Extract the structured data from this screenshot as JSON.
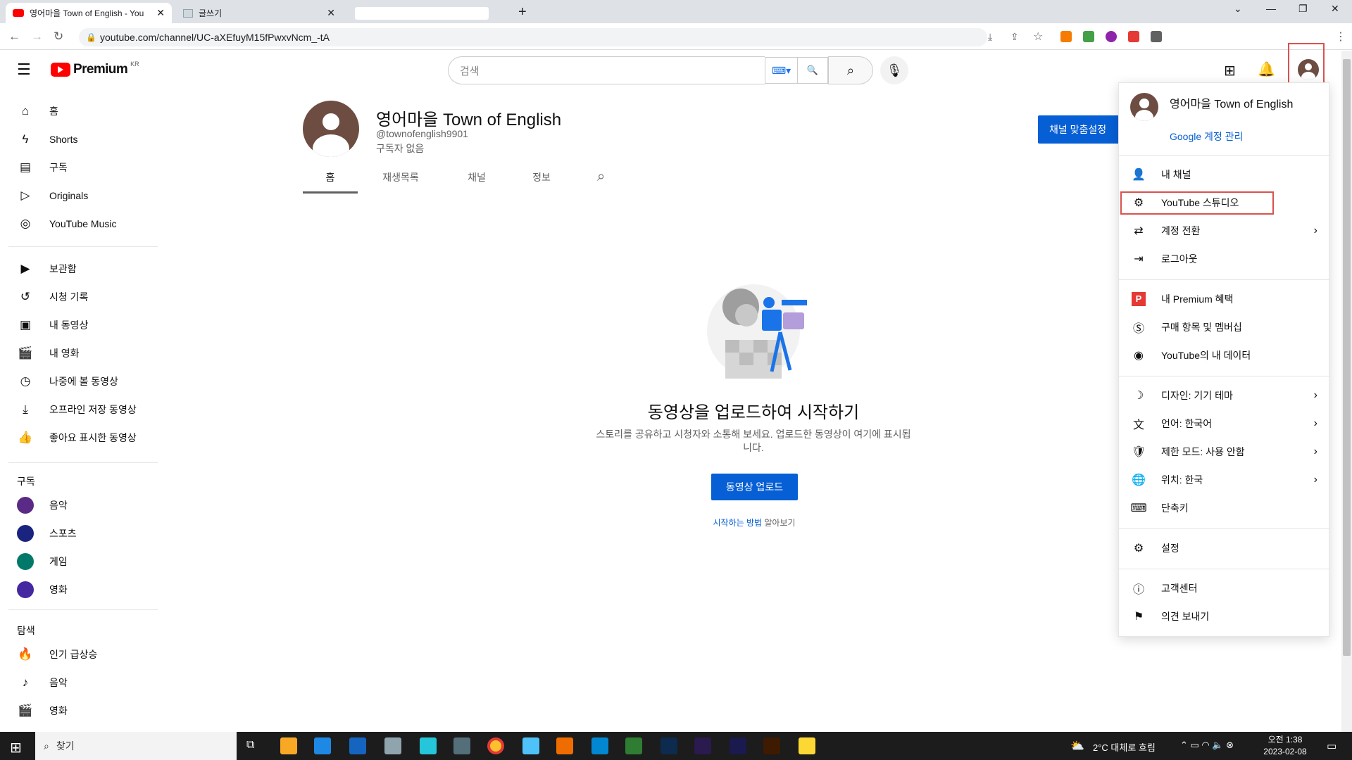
{
  "browser": {
    "tabs": [
      {
        "title": "영어마을 Town of English - You"
      },
      {
        "title": "글쓰기"
      },
      {
        "title": ""
      }
    ],
    "url": "youtube.com/channel/UC-aXEfuyM15fPwxvNcm_-tA"
  },
  "header": {
    "logo": "Premium",
    "region": "KR",
    "search_placeholder": "검색"
  },
  "sidebar": {
    "main": [
      {
        "label": "홈",
        "icon": "home-icon"
      },
      {
        "label": "Shorts",
        "icon": "shorts-icon"
      },
      {
        "label": "구독",
        "icon": "subscriptions-icon"
      },
      {
        "label": "Originals",
        "icon": "originals-icon"
      },
      {
        "label": "YouTube Music",
        "icon": "music-icon"
      }
    ],
    "library": [
      {
        "label": "보관함",
        "icon": "library-icon"
      },
      {
        "label": "시청 기록",
        "icon": "history-icon"
      },
      {
        "label": "내 동영상",
        "icon": "my-videos-icon"
      },
      {
        "label": "내 영화",
        "icon": "my-movies-icon"
      },
      {
        "label": "나중에 볼 동영상",
        "icon": "watch-later-icon"
      },
      {
        "label": "오프라인 저장 동영상",
        "icon": "download-icon"
      },
      {
        "label": "좋아요 표시한 동영상",
        "icon": "like-icon"
      }
    ],
    "subscriptions_title": "구독",
    "subscriptions": [
      {
        "label": "음악",
        "color": "#5b2a86"
      },
      {
        "label": "스포츠",
        "color": "#1a237e"
      },
      {
        "label": "게임",
        "color": "#00796b"
      },
      {
        "label": "영화",
        "color": "#4527a0"
      }
    ],
    "explore_title": "탐색",
    "explore": [
      {
        "label": "인기 급상승",
        "icon": "trending-icon"
      },
      {
        "label": "음악",
        "icon": "music-note-icon"
      },
      {
        "label": "영화",
        "icon": "movies-icon"
      }
    ]
  },
  "channel": {
    "name": "영어마을 Town of English",
    "handle": "@townofenglish9901",
    "subscribers": "구독자 없음",
    "customize_label": "채널 맞춤설정",
    "tabs": [
      "홈",
      "재생목록",
      "채널",
      "정보"
    ]
  },
  "empty": {
    "title": "동영상을 업로드하여 시작하기",
    "desc_line1": "스토리를 공유하고 시청자와 소통해 보세요. 업로드한 동영상이 여기에 표시됩",
    "desc_line2": "니다.",
    "upload_label": "동영상 업로드",
    "howto_link": "시작하는 방법",
    "howto_rest": " 알아보기"
  },
  "account_menu": {
    "name": "영어마을 Town of English",
    "manage": "Google 계정 관리",
    "group1": [
      {
        "label": "내 채널",
        "icon": "channel-icon"
      },
      {
        "label": "YouTube 스튜디오",
        "icon": "studio-icon"
      },
      {
        "label": "계정 전환",
        "icon": "switch-account-icon",
        "arrow": true
      },
      {
        "label": "로그아웃",
        "icon": "logout-icon"
      }
    ],
    "group2": [
      {
        "label": "내 Premium 혜택",
        "icon": "premium-icon"
      },
      {
        "label": "구매 항목 및 멤버십",
        "icon": "purchases-icon"
      },
      {
        "label": "YouTube의 내 데이터",
        "icon": "data-icon"
      }
    ],
    "group3": [
      {
        "label": "디자인: 기기 테마",
        "icon": "theme-icon",
        "arrow": true
      },
      {
        "label": "언어: 한국어",
        "icon": "language-icon",
        "arrow": true
      },
      {
        "label": "제한 모드: 사용 안함",
        "icon": "restricted-icon",
        "arrow": true
      },
      {
        "label": "위치: 한국",
        "icon": "globe-icon",
        "arrow": true
      },
      {
        "label": "단축키",
        "icon": "keyboard-icon"
      }
    ],
    "group4": [
      {
        "label": "설정",
        "icon": "settings-icon"
      }
    ],
    "group5": [
      {
        "label": "고객센터",
        "icon": "help-icon"
      },
      {
        "label": "의견 보내기",
        "icon": "feedback-icon"
      }
    ]
  },
  "taskbar": {
    "search_label": "찾기",
    "weather": "2°C  대체로 흐림",
    "time": "오전 1:38",
    "date": "2023-02-08"
  }
}
